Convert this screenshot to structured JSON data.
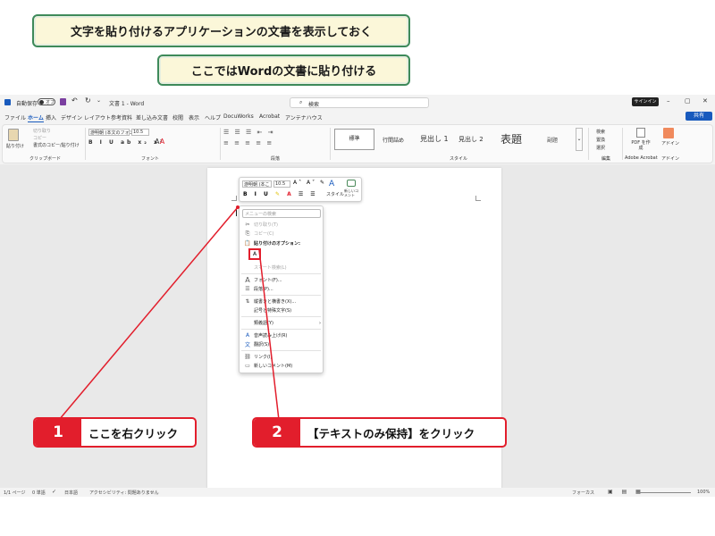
{
  "callouts": {
    "top": "文字を貼り付けるアプリケーションの文書を表示しておく",
    "second": "ここではWordの文書に貼り付ける"
  },
  "titlebar": {
    "autosave": "自動保存",
    "autosave_state": "オフ",
    "doc_title": "文書 1 - Word",
    "search": "検索",
    "signin": "サインイン"
  },
  "menu": {
    "tabs": [
      "ファイル",
      "ホーム",
      "挿入",
      "デザイン",
      "レイアウト",
      "参考資料",
      "差し込み文書",
      "校閲",
      "表示",
      "ヘルプ",
      "DocuWorks",
      "Acrobat",
      "アンテナハウス"
    ],
    "share": "共有"
  },
  "ribbon": {
    "paste": "貼り付け",
    "cut": "切り取り",
    "copy": "コピー",
    "format_copy": "書式のコピー/貼り付け",
    "font_name": "游明朝 (本文のフォン",
    "font_size": "10.5",
    "styles": [
      "標準",
      "行間詰め",
      "見出し 1",
      "見出し 2",
      "表題",
      "副題"
    ],
    "find": "検索",
    "replace": "置換",
    "select": "選択",
    "pdf": "PDF を作成",
    "addins": "アドイン",
    "groups": [
      "クリップボード",
      "フォント",
      "段落",
      "スタイル",
      "編集",
      "Adobe Acrobat",
      "アドイン"
    ]
  },
  "minitoolbar": {
    "font_name": "游明朝 (本こ",
    "font_size": "10.5",
    "style": "スタイル",
    "new_comment": "新しいコメント"
  },
  "context_menu": {
    "search_placeholder": "メニューの検索",
    "cut": "切り取り(T)",
    "copy": "コピー(C)",
    "paste_options": "貼り付けのオプション:",
    "smart_lookup": "スマート検索(L)",
    "font": "フォント(F)...",
    "paragraph": "段落(P)...",
    "vertical": "縦書きと横書き(X)...",
    "symbol": "記号と特殊文字(S)",
    "synonyms": "類義語(Y)",
    "read_aloud": "音声読み上げ(R)",
    "translate": "翻訳(S)",
    "link": "リンク(I)",
    "new_comment": "新しいコメント(M)"
  },
  "steps": [
    {
      "num": "1",
      "text": "ここを右クリック"
    },
    {
      "num": "2",
      "text": "【テキストのみ保持】をクリック"
    }
  ],
  "status": {
    "page": "1/1 ページ",
    "words": "0 単語",
    "lang": "日本語",
    "accessibility": "アクセシビリティ: 問題ありません",
    "focus": "フォーカス",
    "zoom": "100%"
  },
  "colors": {
    "accent_red": "#e21e2c",
    "callout_border": "#3e8a5a",
    "callout_bg": "#fbf7d9",
    "word_blue": "#185abd"
  }
}
